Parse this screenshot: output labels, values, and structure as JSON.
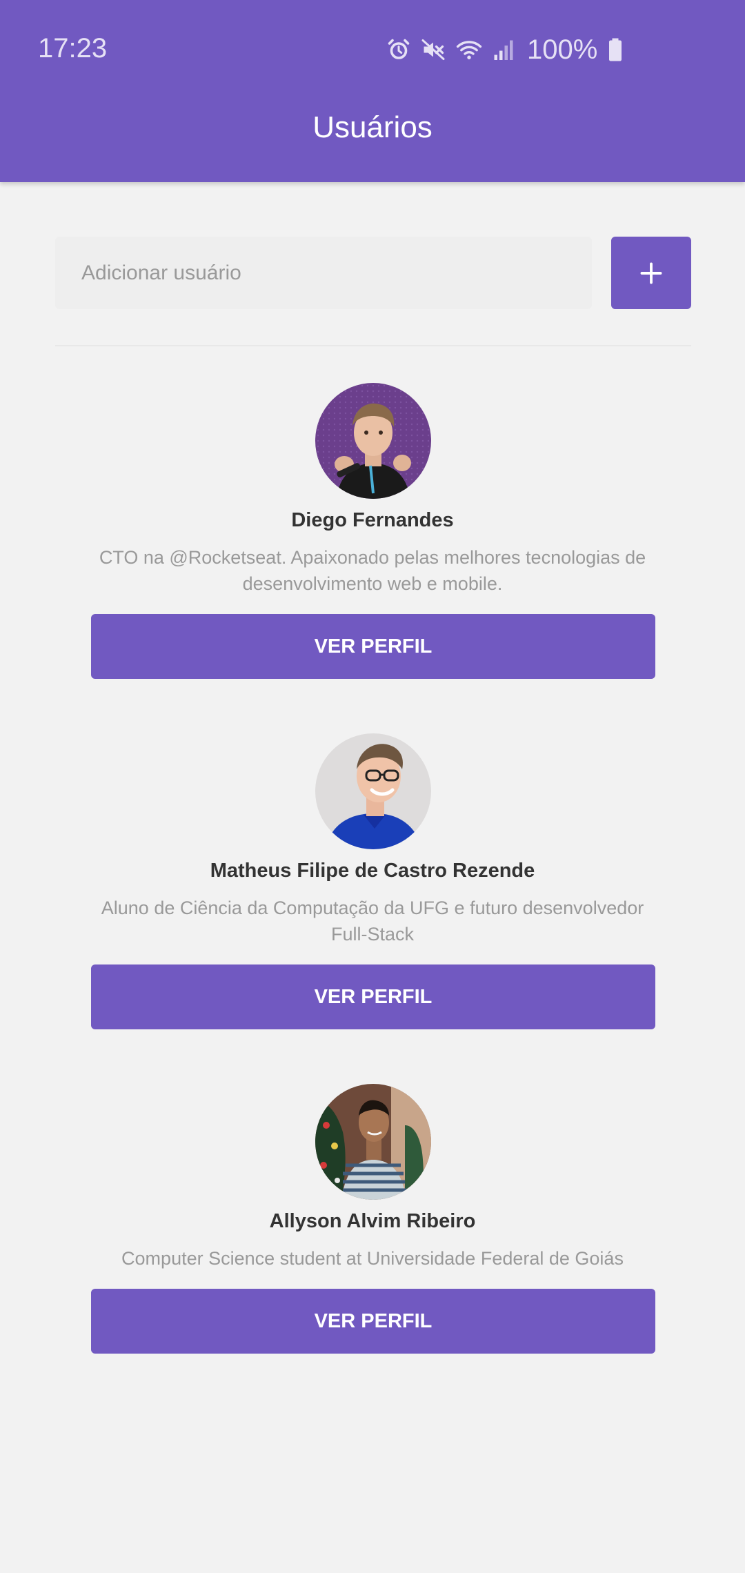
{
  "status_bar": {
    "time": "17:23",
    "battery": "100%",
    "icons": [
      "alarm-icon",
      "mute-icon",
      "wifi-icon",
      "signal-icon",
      "battery-icon"
    ]
  },
  "header": {
    "title": "Usuários",
    "color": "#7159c1"
  },
  "form": {
    "placeholder": "Adicionar usuário",
    "value": "",
    "add_icon": "plus-icon"
  },
  "users": [
    {
      "name": "Diego Fernandes",
      "bio": "CTO na @Rocketseat. Apaixonado pelas melhores tecnologias de desenvolvimento web e mobile.",
      "button": "VER PERFIL"
    },
    {
      "name": "Matheus Filipe de Castro Rezende",
      "bio": "Aluno de Ciência da Computação da UFG e futuro desenvolvedor Full-Stack",
      "button": "VER PERFIL"
    },
    {
      "name": "Allyson Alvim Ribeiro",
      "bio": "Computer Science student at Universidade Federal de Goiás",
      "button": "VER PERFIL"
    }
  ]
}
